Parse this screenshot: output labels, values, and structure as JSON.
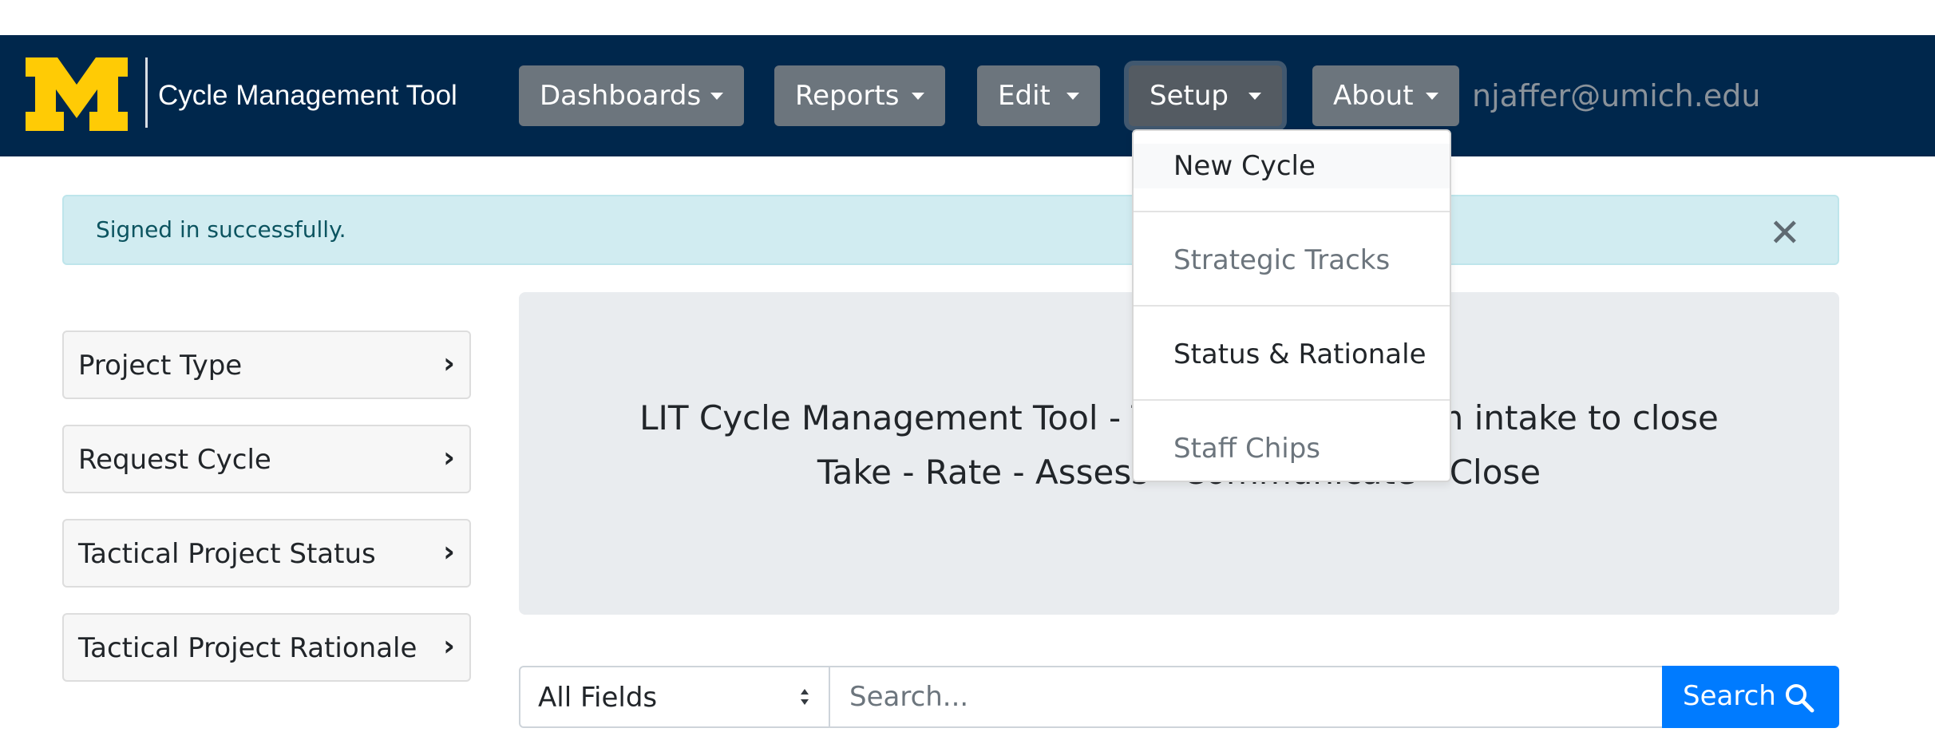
{
  "brand": {
    "title": "Cycle Management Tool",
    "logo": "block-m-logo",
    "logo_color": "#ffcb05",
    "bar_color": "#00274c"
  },
  "nav": {
    "items": [
      {
        "label": "Dashboards"
      },
      {
        "label": "Reports"
      },
      {
        "label": "Edit"
      },
      {
        "label": "Setup"
      },
      {
        "label": "About"
      }
    ],
    "active": "Setup",
    "user_email": "njaffer@umich.edu"
  },
  "setup_menu": {
    "items": [
      {
        "label": "New Cycle"
      },
      {
        "label": "Strategic Tracks"
      },
      {
        "label": "Status & Rationale"
      },
      {
        "label": "Staff Chips"
      }
    ]
  },
  "alert": {
    "message": "Signed in successfully.",
    "close_icon": "close-icon"
  },
  "sidebar": {
    "items": [
      {
        "label": "Project Type"
      },
      {
        "label": "Request Cycle"
      },
      {
        "label": "Tactical Project Status"
      },
      {
        "label": "Tactical Project Rationale"
      }
    ],
    "chevron": "›"
  },
  "jumbotron": {
    "line1": "LIT Cycle Management Tool - Track requests from intake to close",
    "line2": "Take - Rate - Assess - Communicate - Close"
  },
  "search": {
    "field_value": "All Fields",
    "placeholder": "Search...",
    "button_label": "Search",
    "button_color": "#007bff"
  }
}
